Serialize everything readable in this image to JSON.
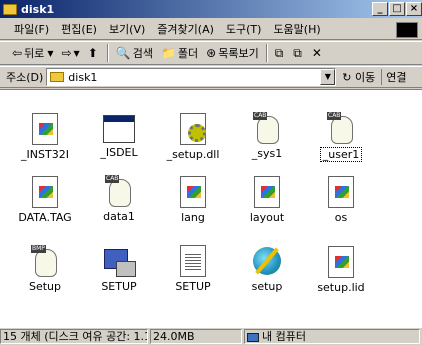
{
  "window": {
    "title": "disk1",
    "buttons": {
      "minimize": "_",
      "maximize": "□",
      "close": "×"
    }
  },
  "menu": [
    "파일(F)",
    "편집(E)",
    "보기(V)",
    "즐겨찾기(A)",
    "도구(T)",
    "도움말(H)"
  ],
  "toolbar": {
    "back": "뒤로",
    "back_glyph": "⇦",
    "forward_glyph": "⇨",
    "up_glyph": "⬆",
    "search": "검색",
    "folders": "폴더",
    "history": "목록보기",
    "move_glyph": "⧉",
    "copy_glyph": "⧉",
    "delete_glyph": "✕"
  },
  "address": {
    "label": "주소(D)",
    "value": "disk1",
    "go": "이동",
    "links": "연결"
  },
  "files": [
    {
      "name": "_INST32I",
      "icon": "exe-icon",
      "selected": false
    },
    {
      "name": "_ISDEL",
      "icon": "window-icon",
      "selected": false
    },
    {
      "name": "_setup.dll",
      "icon": "dll-icon",
      "selected": false
    },
    {
      "name": "_sys1",
      "icon": "cab-icon",
      "selected": false
    },
    {
      "name": "_user1",
      "icon": "cab-icon",
      "selected": true
    },
    {
      "name": "DATA.TAG",
      "icon": "exe-icon",
      "selected": false
    },
    {
      "name": "data1",
      "icon": "cab-icon",
      "selected": false
    },
    {
      "name": "lang",
      "icon": "exe-icon",
      "selected": false
    },
    {
      "name": "layout",
      "icon": "exe-icon",
      "selected": false
    },
    {
      "name": "os",
      "icon": "exe-icon",
      "selected": false
    },
    {
      "name": "Setup",
      "icon": "bmp-icon",
      "selected": false
    },
    {
      "name": "SETUP",
      "icon": "setup-icon",
      "selected": false
    },
    {
      "name": "SETUP",
      "icon": "ini-icon",
      "selected": false
    },
    {
      "name": "setup",
      "icon": "globe-icon",
      "selected": false
    },
    {
      "name": "setup.lid",
      "icon": "exe-icon",
      "selected": false
    }
  ],
  "status": {
    "objects": "15 개체 (디스크 여유 공간: 1.1",
    "size": "24.0MB",
    "zone": "내 컴퓨터"
  }
}
